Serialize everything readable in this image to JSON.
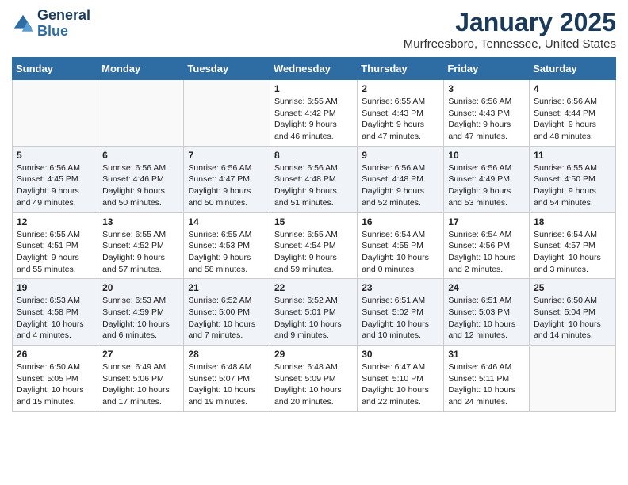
{
  "header": {
    "logo_line1": "General",
    "logo_line2": "Blue",
    "month": "January 2025",
    "location": "Murfreesboro, Tennessee, United States"
  },
  "weekdays": [
    "Sunday",
    "Monday",
    "Tuesday",
    "Wednesday",
    "Thursday",
    "Friday",
    "Saturday"
  ],
  "weeks": [
    [
      {
        "day": "",
        "info": ""
      },
      {
        "day": "",
        "info": ""
      },
      {
        "day": "",
        "info": ""
      },
      {
        "day": "1",
        "info": "Sunrise: 6:55 AM\nSunset: 4:42 PM\nDaylight: 9 hours\nand 46 minutes."
      },
      {
        "day": "2",
        "info": "Sunrise: 6:55 AM\nSunset: 4:43 PM\nDaylight: 9 hours\nand 47 minutes."
      },
      {
        "day": "3",
        "info": "Sunrise: 6:56 AM\nSunset: 4:43 PM\nDaylight: 9 hours\nand 47 minutes."
      },
      {
        "day": "4",
        "info": "Sunrise: 6:56 AM\nSunset: 4:44 PM\nDaylight: 9 hours\nand 48 minutes."
      }
    ],
    [
      {
        "day": "5",
        "info": "Sunrise: 6:56 AM\nSunset: 4:45 PM\nDaylight: 9 hours\nand 49 minutes."
      },
      {
        "day": "6",
        "info": "Sunrise: 6:56 AM\nSunset: 4:46 PM\nDaylight: 9 hours\nand 50 minutes."
      },
      {
        "day": "7",
        "info": "Sunrise: 6:56 AM\nSunset: 4:47 PM\nDaylight: 9 hours\nand 50 minutes."
      },
      {
        "day": "8",
        "info": "Sunrise: 6:56 AM\nSunset: 4:48 PM\nDaylight: 9 hours\nand 51 minutes."
      },
      {
        "day": "9",
        "info": "Sunrise: 6:56 AM\nSunset: 4:48 PM\nDaylight: 9 hours\nand 52 minutes."
      },
      {
        "day": "10",
        "info": "Sunrise: 6:56 AM\nSunset: 4:49 PM\nDaylight: 9 hours\nand 53 minutes."
      },
      {
        "day": "11",
        "info": "Sunrise: 6:55 AM\nSunset: 4:50 PM\nDaylight: 9 hours\nand 54 minutes."
      }
    ],
    [
      {
        "day": "12",
        "info": "Sunrise: 6:55 AM\nSunset: 4:51 PM\nDaylight: 9 hours\nand 55 minutes."
      },
      {
        "day": "13",
        "info": "Sunrise: 6:55 AM\nSunset: 4:52 PM\nDaylight: 9 hours\nand 57 minutes."
      },
      {
        "day": "14",
        "info": "Sunrise: 6:55 AM\nSunset: 4:53 PM\nDaylight: 9 hours\nand 58 minutes."
      },
      {
        "day": "15",
        "info": "Sunrise: 6:55 AM\nSunset: 4:54 PM\nDaylight: 9 hours\nand 59 minutes."
      },
      {
        "day": "16",
        "info": "Sunrise: 6:54 AM\nSunset: 4:55 PM\nDaylight: 10 hours\nand 0 minutes."
      },
      {
        "day": "17",
        "info": "Sunrise: 6:54 AM\nSunset: 4:56 PM\nDaylight: 10 hours\nand 2 minutes."
      },
      {
        "day": "18",
        "info": "Sunrise: 6:54 AM\nSunset: 4:57 PM\nDaylight: 10 hours\nand 3 minutes."
      }
    ],
    [
      {
        "day": "19",
        "info": "Sunrise: 6:53 AM\nSunset: 4:58 PM\nDaylight: 10 hours\nand 4 minutes."
      },
      {
        "day": "20",
        "info": "Sunrise: 6:53 AM\nSunset: 4:59 PM\nDaylight: 10 hours\nand 6 minutes."
      },
      {
        "day": "21",
        "info": "Sunrise: 6:52 AM\nSunset: 5:00 PM\nDaylight: 10 hours\nand 7 minutes."
      },
      {
        "day": "22",
        "info": "Sunrise: 6:52 AM\nSunset: 5:01 PM\nDaylight: 10 hours\nand 9 minutes."
      },
      {
        "day": "23",
        "info": "Sunrise: 6:51 AM\nSunset: 5:02 PM\nDaylight: 10 hours\nand 10 minutes."
      },
      {
        "day": "24",
        "info": "Sunrise: 6:51 AM\nSunset: 5:03 PM\nDaylight: 10 hours\nand 12 minutes."
      },
      {
        "day": "25",
        "info": "Sunrise: 6:50 AM\nSunset: 5:04 PM\nDaylight: 10 hours\nand 14 minutes."
      }
    ],
    [
      {
        "day": "26",
        "info": "Sunrise: 6:50 AM\nSunset: 5:05 PM\nDaylight: 10 hours\nand 15 minutes."
      },
      {
        "day": "27",
        "info": "Sunrise: 6:49 AM\nSunset: 5:06 PM\nDaylight: 10 hours\nand 17 minutes."
      },
      {
        "day": "28",
        "info": "Sunrise: 6:48 AM\nSunset: 5:07 PM\nDaylight: 10 hours\nand 19 minutes."
      },
      {
        "day": "29",
        "info": "Sunrise: 6:48 AM\nSunset: 5:09 PM\nDaylight: 10 hours\nand 20 minutes."
      },
      {
        "day": "30",
        "info": "Sunrise: 6:47 AM\nSunset: 5:10 PM\nDaylight: 10 hours\nand 22 minutes."
      },
      {
        "day": "31",
        "info": "Sunrise: 6:46 AM\nSunset: 5:11 PM\nDaylight: 10 hours\nand 24 minutes."
      },
      {
        "day": "",
        "info": ""
      }
    ]
  ]
}
